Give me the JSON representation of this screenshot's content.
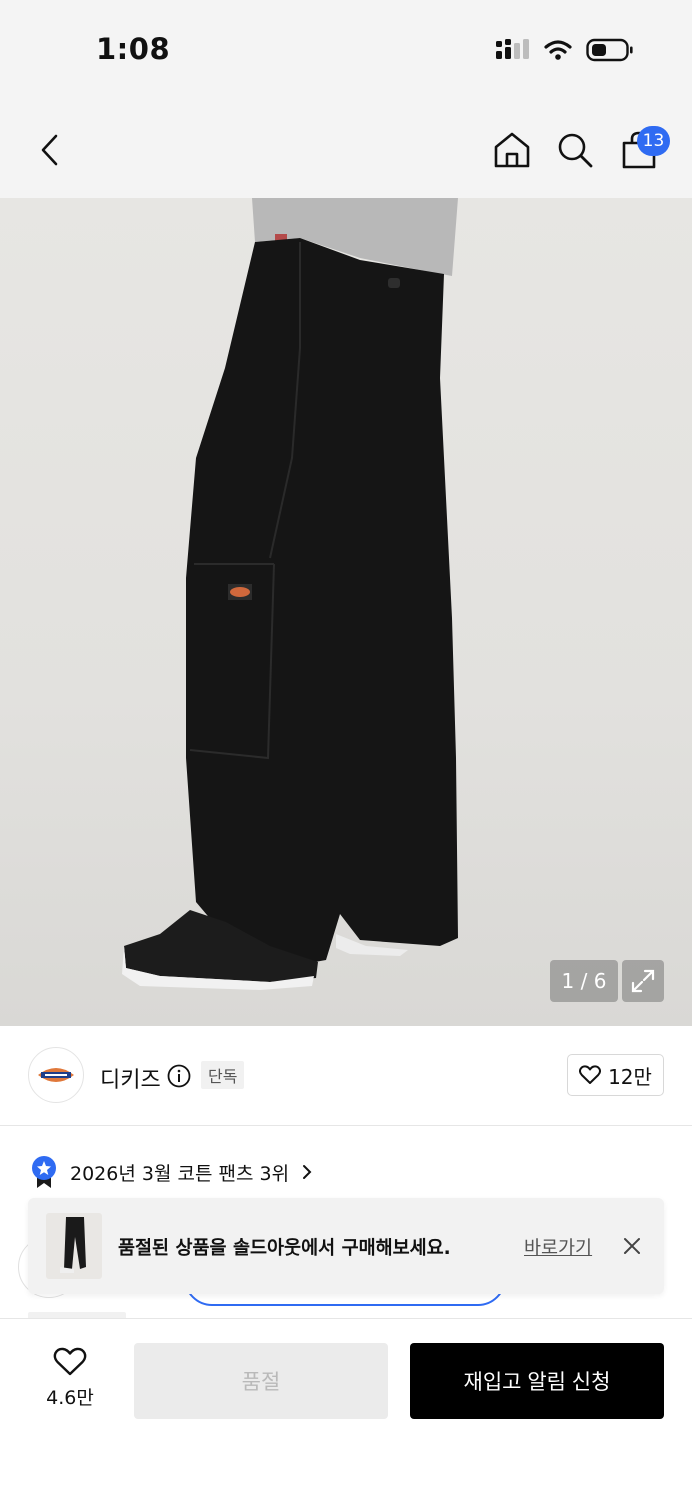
{
  "status_bar": {
    "time": "1:08"
  },
  "nav": {
    "cart_count": "13",
    "icons": [
      "back-arrow-icon",
      "home-icon",
      "search-icon",
      "shopping-bag-icon"
    ]
  },
  "gallery": {
    "counter": "1 / 6"
  },
  "brand": {
    "name": "디키즈",
    "badge": "단독",
    "likes": "12만"
  },
  "ranking": {
    "text": "2026년 3월 코튼 팬츠 3위"
  },
  "toast": {
    "message": "품절된 상품을 솔드아웃에서 구매해보세요.",
    "link_label": "바로가기"
  },
  "bottom_bar": {
    "wish_count": "4.6만",
    "soldout_label": "품절",
    "restock_label": "재입고 알림 신청"
  },
  "colors": {
    "accent": "#2f6bf2",
    "primary_button": "#000000",
    "disabled_button": "#ebebeb"
  }
}
